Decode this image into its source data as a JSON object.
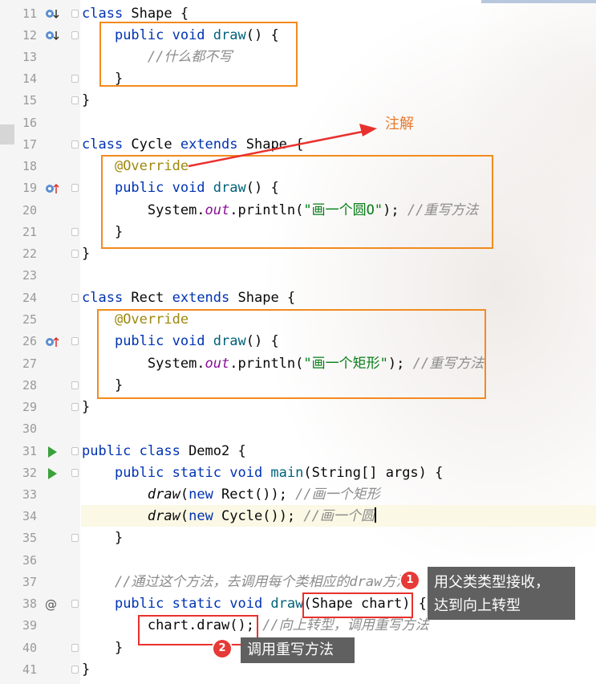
{
  "editor": {
    "lines": [
      {
        "no": "11",
        "icon": "override-down-icon"
      },
      {
        "no": "12",
        "icon": "override-down-icon"
      },
      {
        "no": "13",
        "icon": ""
      },
      {
        "no": "14",
        "icon": ""
      },
      {
        "no": "15",
        "icon": ""
      },
      {
        "no": "16",
        "icon": ""
      },
      {
        "no": "17",
        "icon": ""
      },
      {
        "no": "18",
        "icon": ""
      },
      {
        "no": "19",
        "icon": "override-up-icon"
      },
      {
        "no": "20",
        "icon": ""
      },
      {
        "no": "21",
        "icon": ""
      },
      {
        "no": "22",
        "icon": ""
      },
      {
        "no": "23",
        "icon": ""
      },
      {
        "no": "24",
        "icon": ""
      },
      {
        "no": "25",
        "icon": ""
      },
      {
        "no": "26",
        "icon": "override-up-icon"
      },
      {
        "no": "27",
        "icon": ""
      },
      {
        "no": "28",
        "icon": ""
      },
      {
        "no": "29",
        "icon": ""
      },
      {
        "no": "30",
        "icon": ""
      },
      {
        "no": "31",
        "icon": "run-icon"
      },
      {
        "no": "32",
        "icon": "run-icon"
      },
      {
        "no": "33",
        "icon": ""
      },
      {
        "no": "34",
        "icon": ""
      },
      {
        "no": "35",
        "icon": ""
      },
      {
        "no": "36",
        "icon": ""
      },
      {
        "no": "37",
        "icon": ""
      },
      {
        "no": "38",
        "icon": "at-icon"
      },
      {
        "no": "39",
        "icon": ""
      },
      {
        "no": "40",
        "icon": ""
      },
      {
        "no": "41",
        "icon": ""
      }
    ],
    "code": {
      "l11": {
        "kw": "class",
        "name": " Shape {"
      },
      "l12": {
        "kw": "public void ",
        "fn": "draw",
        "rest": "() {"
      },
      "l13": {
        "comment": "//什么都不写"
      },
      "l14": {
        "text": "}"
      },
      "l15": {
        "text": "}"
      },
      "l17": {
        "kw1": "class",
        "name": " Cycle ",
        "kw2": "extends",
        "rest": " Shape {"
      },
      "l18": {
        "ann": "@Override"
      },
      "l19": {
        "kw": "public void ",
        "fn": "draw",
        "rest": "() {"
      },
      "l20": {
        "a": "System.",
        "field": "out",
        "b": ".println(",
        "str": "\"画一个圆O\"",
        "c": "); ",
        "comment": "//重写方法"
      },
      "l21": {
        "text": "}"
      },
      "l22": {
        "text": "}"
      },
      "l24": {
        "kw1": "class",
        "name": " Rect ",
        "kw2": "extends",
        "rest": " Shape {"
      },
      "l25": {
        "ann": "@Override"
      },
      "l26": {
        "kw": "public void ",
        "fn": "draw",
        "rest": "() {"
      },
      "l27": {
        "a": "System.",
        "field": "out",
        "b": ".println(",
        "str": "\"画一个矩形\"",
        "c": "); ",
        "comment": "//重写方法"
      },
      "l28": {
        "text": "}"
      },
      "l29": {
        "text": "}"
      },
      "l31": {
        "kw": "public class",
        "rest": " Demo2 {"
      },
      "l32": {
        "kw": "public static void ",
        "fn": "main",
        "rest": "(String[] args) {"
      },
      "l33": {
        "call": "draw",
        "p": "(",
        "kw": "new",
        "rest": " Rect()); ",
        "comment": "//画一个矩形"
      },
      "l34": {
        "call": "draw",
        "p": "(",
        "kw": "new",
        "rest": " Cycle()); ",
        "comment": "//画一个圆"
      },
      "l35": {
        "text": "}"
      },
      "l37": {
        "comment": "//通过这个方法，去调用每个类相应的draw方法"
      },
      "l38": {
        "kw": "public static void ",
        "fn": "draw",
        "rest": "(Shape chart) {"
      },
      "l39": {
        "text": "chart.draw(); ",
        "comment": "//向上转型，调用重写方法"
      },
      "l40": {
        "text": "}"
      },
      "l41": {
        "text": "}"
      }
    }
  },
  "annotations": {
    "note_label": "注解",
    "tip1": {
      "badge": "1",
      "line1": "用父类类型接收，",
      "line2": "达到向上转型"
    },
    "tip2": {
      "badge": "2",
      "text": "调用重写方法"
    }
  },
  "colors": {
    "orange_box": "#f28b1e",
    "red_box": "#e8312e",
    "arrow_red": "#e8312e",
    "keyword": "#0033b3",
    "annotation": "#9e880d",
    "string": "#067d17",
    "comment": "#8c8c8c"
  }
}
